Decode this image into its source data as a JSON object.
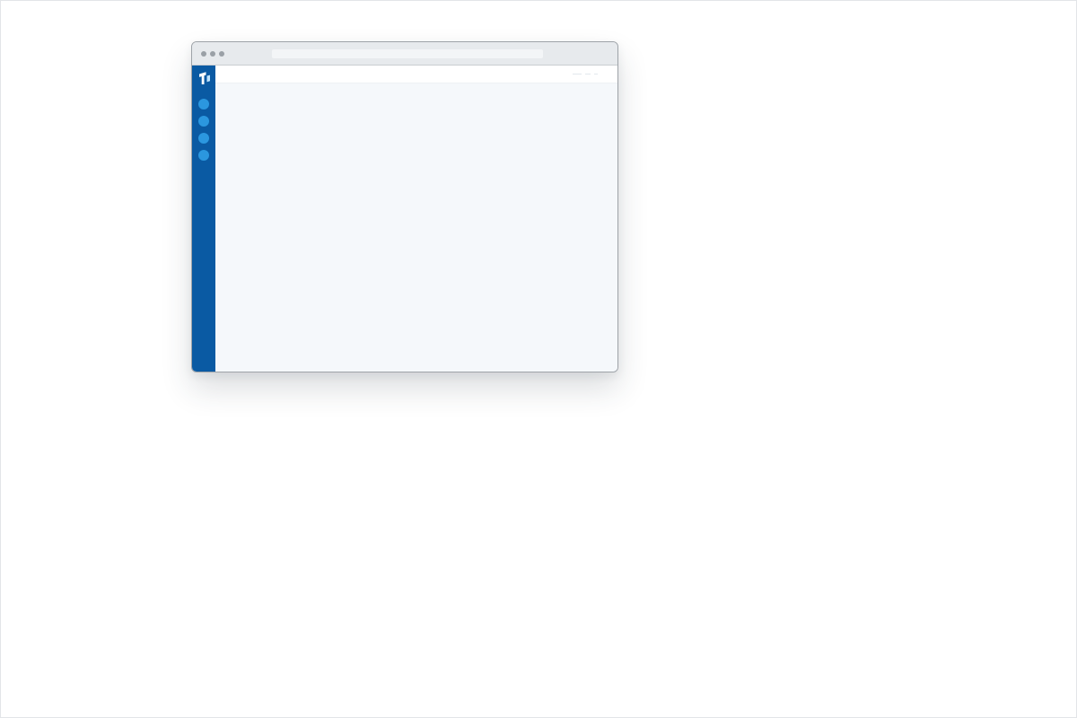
{
  "window": {
    "address_text": ""
  },
  "sidebar": {
    "logo_icon": "brand-logo-icon",
    "items": [
      {
        "icon": "nav-circle-icon",
        "label": ""
      },
      {
        "icon": "nav-circle-icon",
        "label": ""
      },
      {
        "icon": "nav-circle-icon",
        "label": ""
      },
      {
        "icon": "nav-circle-icon",
        "label": ""
      }
    ]
  },
  "colors": {
    "sidebar": "#0a5aa3",
    "nav_item": "#2b97df",
    "titlebar": "#e7eaed",
    "content_background": "#f5f8fb",
    "window_border": "#9ea3a8"
  }
}
